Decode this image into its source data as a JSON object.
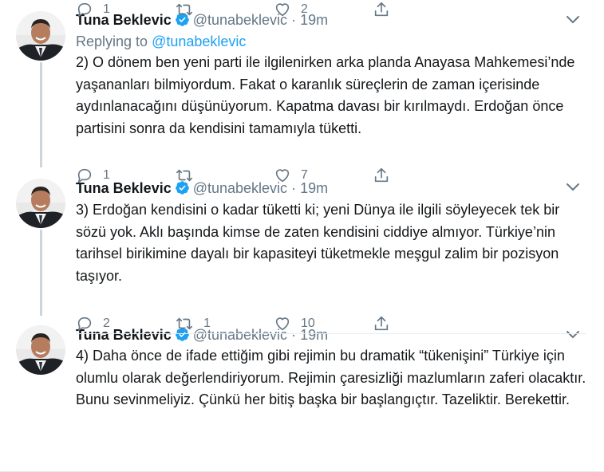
{
  "tweets": [
    {
      "name": "Tuna Beklevic",
      "handle": "@tunabeklevic",
      "dot": "·",
      "time": "19m",
      "replying_prefix": "Replying to ",
      "replying_handle": "@tunabeklevic",
      "text": "2) O dönem ben yeni parti ile ilgilenirken arka planda Anayasa Mahkemesi’nde yaşananları bilmiyordum. Fakat o karanlık süreçlerin de zaman içerisinde aydınlanacağını düşünüyorum. Kapatma davası bir kırılmaydı. Erdoğan önce partisini sonra da kendisini tamamıyla tüketti.",
      "reply_count": "1",
      "retweet_count": "",
      "like_count": "2"
    },
    {
      "name": "Tuna Beklevic",
      "handle": "@tunabeklevic",
      "dot": "·",
      "time": "19m",
      "text": "3) Erdoğan kendisini o kadar tüketti ki; yeni Dünya ile ilgili söyleyecek tek bir sözü yok. Aklı başında kimse de zaten kendisini ciddiye almıyor.  Türkiye’nin tarihsel birikimine dayalı bir kapasiteyi tüketmekle meşgul zalim bir pozisyon taşıyor.",
      "reply_count": "1",
      "retweet_count": "",
      "like_count": "7"
    },
    {
      "name": "Tuna Beklevic",
      "handle": "@tunabeklevic",
      "dot": "·",
      "time": "19m",
      "text": "4) Daha önce de ifade ettiğim gibi rejimin bu dramatik “tükenişini” Türkiye için olumlu olarak değerlendiriyorum. Rejimin çaresizliği mazlumların zaferi olacaktır. Bunu sevinmeliyiz. Çünkü her bitiş başka bir başlangıçtır. Tazeliktir. Berekettir.",
      "reply_count": "2",
      "retweet_count": "1",
      "like_count": "10"
    }
  ],
  "colors": {
    "accent": "#1da1f2",
    "muted": "#657786",
    "text": "#14171a",
    "thread": "#ccd6dd"
  },
  "icons": [
    "verified-badge-icon",
    "chevron-down-icon",
    "reply-icon",
    "retweet-icon",
    "like-icon",
    "share-icon"
  ]
}
